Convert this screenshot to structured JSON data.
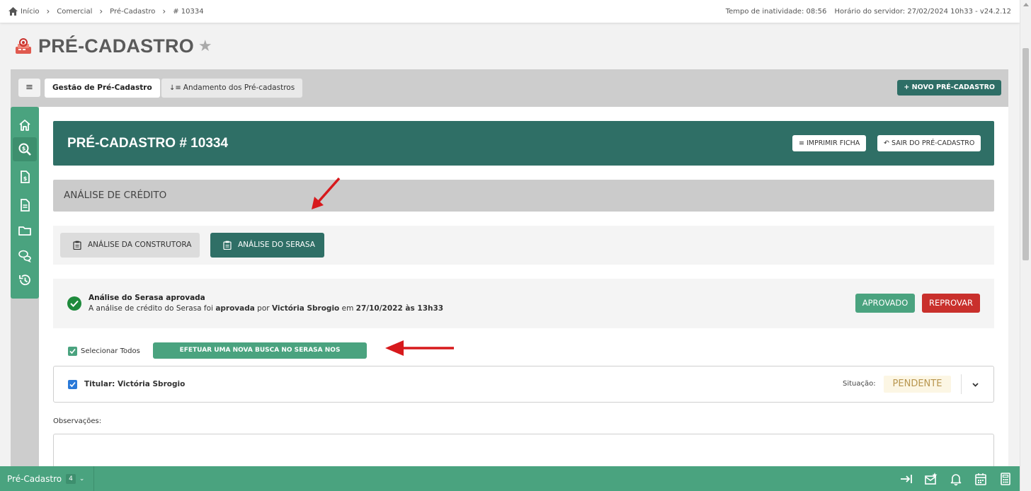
{
  "breadcrumb": {
    "items": [
      "Início",
      "Comercial",
      "Pré-Cadastro",
      "# 10334"
    ]
  },
  "status_top": {
    "inactivity": "Tempo de inatividade: 08:56",
    "server_time": "Horário do servidor: 27/02/2024 10h33 - v24.2.12"
  },
  "page": {
    "title": "PRÉ-CADASTRO"
  },
  "tabs": {
    "menu": "≡",
    "active": "Gestão de Pré-Cadastro",
    "inactive": "Andamento dos Pré-cadastros",
    "new_button": "+ NOVO PRÉ-CADASTRO"
  },
  "sidebar": {
    "items": [
      "home-icon",
      "search-money-icon",
      "invoice-icon",
      "document-icon",
      "folder-icon",
      "chat-icon",
      "history-icon"
    ],
    "active_index": 1
  },
  "header": {
    "title": "PRÉ-CADASTRO # 10334",
    "print_button": "IMPRIMIR FICHA",
    "exit_button": "SAIR DO PRÉ-CADASTRO"
  },
  "section": {
    "title": "ANÁLISE DE CRÉDITO"
  },
  "subtabs": {
    "construtora": "ANÁLISE DA CONSTRUTORA",
    "serasa": "ANÁLISE DO SERASA"
  },
  "status": {
    "title": "Análise do Serasa aprovada",
    "desc_prefix": "A análise de crédito do Serasa foi ",
    "desc_status": "aprovada",
    "desc_by": " por ",
    "desc_user": "Victória Sbrogio",
    "desc_on": " em ",
    "desc_date": "27/10/2022 às 13h33",
    "approve_button": "APROVADO",
    "reject_button": "REPROVAR"
  },
  "selection": {
    "select_all_label": "Selecionar Todos",
    "select_all_checked": true,
    "search_button": "EFETUAR UMA NOVA BUSCA NO SERASA NOS SELECIONADOS"
  },
  "titular": {
    "label": "Titular: Victória Sbrogio",
    "checked": true,
    "situacao_label": "Situação:",
    "situacao_value": "PENDENTE"
  },
  "observacoes": {
    "label": "Observações:",
    "value": ""
  },
  "bottom": {
    "module": "Pré-Cadastro",
    "count": "4",
    "icons": [
      "exit-arrow-icon",
      "mail-star-icon",
      "bell-icon",
      "calendar-icon",
      "calculator-icon"
    ]
  },
  "colors": {
    "primary_dark": "#2f6f66",
    "primary": "#4aa37f",
    "danger": "#c9302c",
    "annotation": "#d7191c"
  }
}
